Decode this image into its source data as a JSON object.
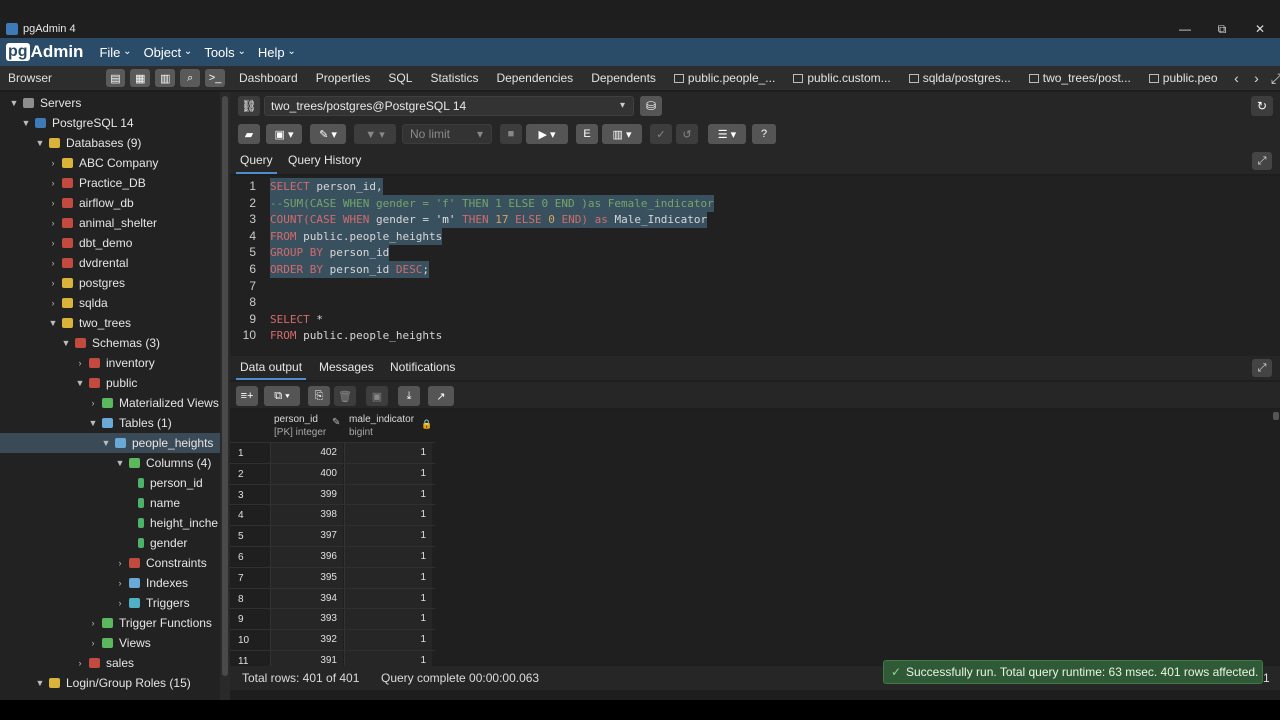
{
  "window": {
    "title": "pgAdmin 4",
    "min": "—",
    "max": "⧉",
    "close": "✕"
  },
  "brand": {
    "pg": "pg",
    "rest": "Admin"
  },
  "menu": [
    "File",
    "Object",
    "Tools",
    "Help"
  ],
  "browser": {
    "label": "Browser"
  },
  "tabs": [
    "Dashboard",
    "Properties",
    "SQL",
    "Statistics",
    "Dependencies",
    "Dependents",
    "public.people_...",
    "public.custom...",
    "sqlda/postgres...",
    "two_trees/post...",
    "public.peo"
  ],
  "tree": {
    "servers": "Servers",
    "pg14": "PostgreSQL 14",
    "databases": "Databases (9)",
    "dbs": [
      "ABC Company",
      "Practice_DB",
      "airflow_db",
      "animal_shelter",
      "dbt_demo",
      "dvdrental",
      "postgres",
      "sqlda"
    ],
    "two_trees": "two_trees",
    "schemas": "Schemas (3)",
    "inventory": "inventory",
    "public": "public",
    "mat_views": "Materialized Views",
    "tables": "Tables (1)",
    "people_heights": "people_heights",
    "columns": "Columns (4)",
    "cols": [
      "person_id",
      "name",
      "height_inche",
      "gender"
    ],
    "constraints": "Constraints",
    "indexes": "Indexes",
    "triggers": "Triggers",
    "trigger_functions": "Trigger Functions",
    "views": "Views",
    "sales": "sales",
    "login": "Login/Group Roles (15)"
  },
  "connection": "two_trees/postgres@PostgreSQL 14",
  "limit": "No limit",
  "query_tabs": {
    "query": "Query",
    "history": "Query History"
  },
  "editor": {
    "line_numbers": [
      "1",
      "2",
      "3",
      "4",
      "5",
      "6",
      "7",
      "8",
      "9",
      "10"
    ],
    "l1": {
      "kw": "SELECT",
      "rest": " person_id,"
    },
    "l2": "--SUM(CASE WHEN gender = 'f' THEN 1 ELSE 0 END )as Female_indicator",
    "l3": {
      "a": "COUNT(CASE WHEN",
      "b": " gender = ",
      "c": "'m'",
      "d": " THEN ",
      "e": "17",
      "f": " ELSE ",
      "g": "0",
      "h": " END)",
      "i": " as ",
      "j": "Male_Indicator"
    },
    "l4": {
      "kw": "FROM",
      "rest": " public.people_heights"
    },
    "l5": {
      "kw": "GROUP BY",
      "rest": " person_id"
    },
    "l6": {
      "kw": "ORDER BY",
      "rest": " person_id ",
      "kw2": "DESC",
      "end": ";"
    },
    "l9": {
      "kw": "SELECT",
      "rest": " *"
    },
    "l10": {
      "kw": "FROM",
      "rest": " public.people_heights"
    }
  },
  "result_tabs": {
    "data": "Data output",
    "messages": "Messages",
    "notifications": "Notifications"
  },
  "grid": {
    "col1": {
      "name": "person_id",
      "type": "[PK] integer"
    },
    "col2": {
      "name": "male_indicator",
      "type": "bigint"
    },
    "rows": [
      {
        "n": "1",
        "id": "402",
        "v": "1"
      },
      {
        "n": "2",
        "id": "400",
        "v": "1"
      },
      {
        "n": "3",
        "id": "399",
        "v": "1"
      },
      {
        "n": "4",
        "id": "398",
        "v": "1"
      },
      {
        "n": "5",
        "id": "397",
        "v": "1"
      },
      {
        "n": "6",
        "id": "396",
        "v": "1"
      },
      {
        "n": "7",
        "id": "395",
        "v": "1"
      },
      {
        "n": "8",
        "id": "394",
        "v": "1"
      },
      {
        "n": "9",
        "id": "393",
        "v": "1"
      },
      {
        "n": "10",
        "id": "392",
        "v": "1"
      },
      {
        "n": "11",
        "id": "391",
        "v": "1"
      }
    ]
  },
  "status": {
    "total": "Total rows: 401 of 401",
    "complete": "Query complete 00:00:00.063",
    "page": "1"
  },
  "toast": "Successfully run. Total query runtime: 63 msec. 401 rows affected.",
  "colors": {
    "accent": "#4d8ed1",
    "menubar": "#2a4c69",
    "success": "#2f5a35"
  }
}
